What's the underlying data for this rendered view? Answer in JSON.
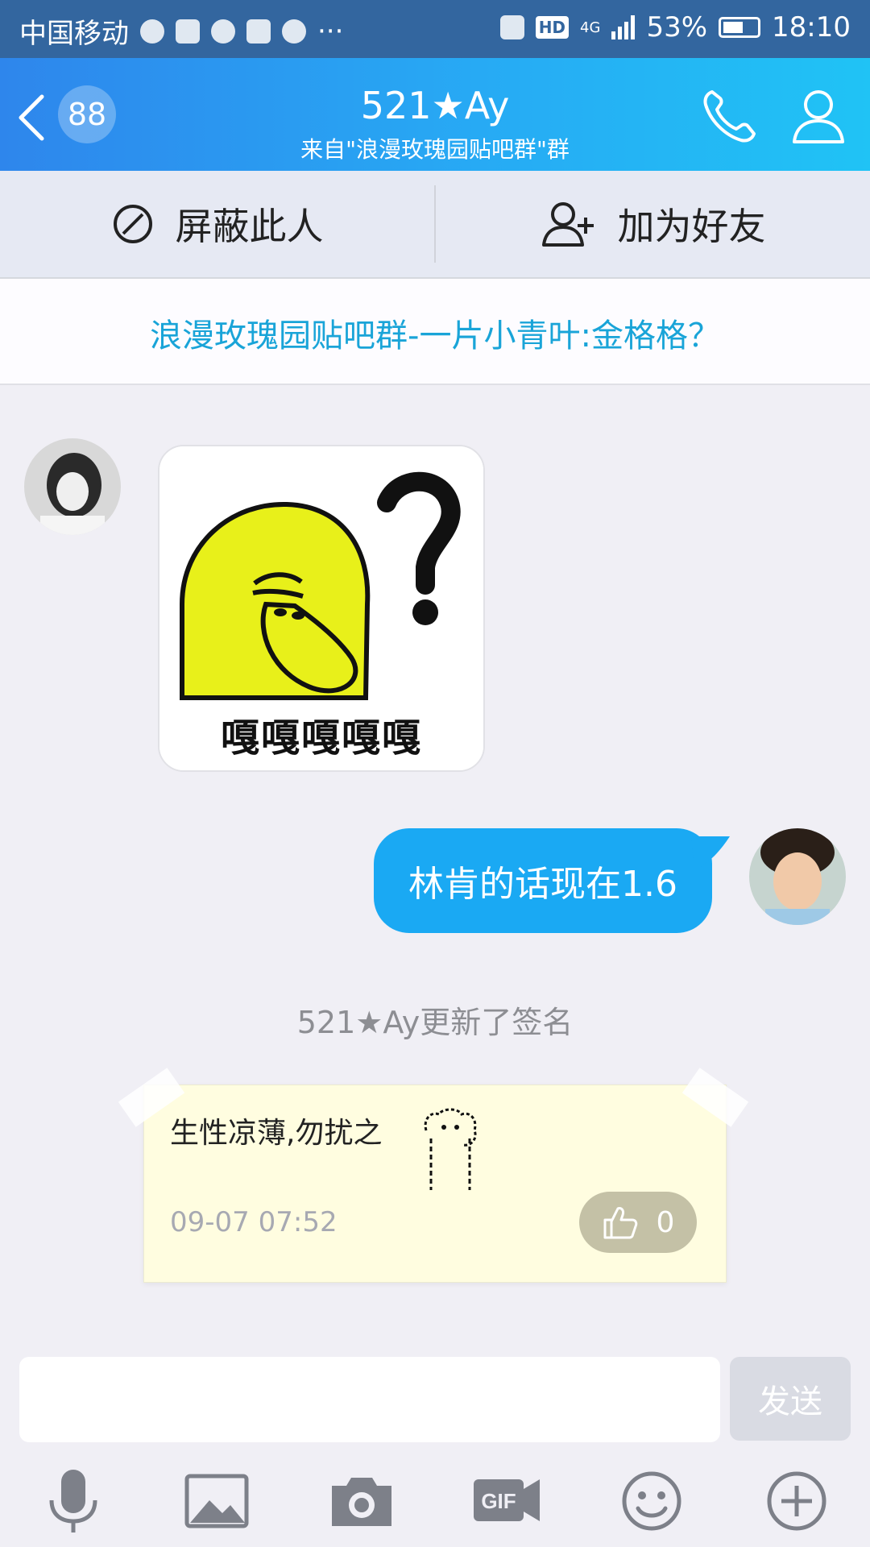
{
  "status_bar": {
    "carrier": "中国移动",
    "battery": "53%",
    "time": "18:10",
    "hd": "HD",
    "network": "4G",
    "more": "···"
  },
  "header": {
    "unread_count": "88",
    "title": "521★Ay",
    "subtitle": "来自\"浪漫玫瑰园贴吧群\"群",
    "back_icon": "chevron-left-icon",
    "call_icon": "phone-icon",
    "profile_icon": "person-icon"
  },
  "actions": {
    "block_label": "屏蔽此人",
    "add_friend_label": "加为好友"
  },
  "notice": {
    "text": "浪漫玫瑰园贴吧群-一片小青叶:金格格？"
  },
  "messages": {
    "sticker_caption": "嘎嘎嘎嘎嘎",
    "outgoing_text": "林肯的话现在1.6",
    "system_text": "521★Ay更新了签名"
  },
  "signature_card": {
    "text": "生性凉薄,勿扰之",
    "time": "09-07 07:52",
    "likes": "0"
  },
  "input_bar": {
    "placeholder": "",
    "send_label": "发送"
  },
  "toolbar": {
    "icons": [
      "microphone-icon",
      "image-icon",
      "camera-icon",
      "gif-icon",
      "emoji-icon",
      "plus-icon"
    ]
  },
  "colors": {
    "header_start": "#2e86ec",
    "header_end": "#20c3f5",
    "bubble": "#1aa9f3",
    "notice_text": "#19a4d8",
    "note_bg": "#fffde0"
  }
}
